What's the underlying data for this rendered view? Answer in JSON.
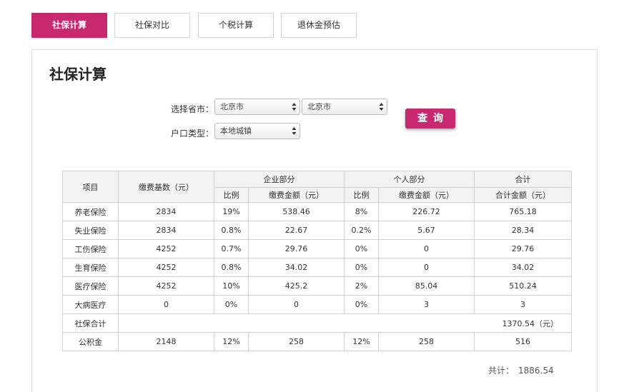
{
  "tabs": [
    {
      "label": "社保计算",
      "active": true
    },
    {
      "label": "社保对比",
      "active": false
    },
    {
      "label": "个税计算",
      "active": false
    },
    {
      "label": "退休金预估",
      "active": false
    }
  ],
  "panel": {
    "title": "社保计算",
    "form": {
      "region_label": "选择省市：",
      "province": "北京市",
      "city": "北京市",
      "hukou_label": "户口类型：",
      "hukou": "本地城镇",
      "query_label": "查询"
    },
    "table": {
      "headers": {
        "item": "项目",
        "base": "缴费基数（元）",
        "enterprise": "企业部分",
        "personal": "个人部分",
        "total": "合计",
        "ratio": "比例",
        "amount": "缴费金额（元）",
        "total_amount": "合计金额（元）"
      },
      "rows": [
        {
          "item": "养老保险",
          "base": "2834",
          "e_ratio": "19%",
          "e_amount": "538.46",
          "p_ratio": "8%",
          "p_amount": "226.72",
          "total": "765.18"
        },
        {
          "item": "失业保险",
          "base": "2834",
          "e_ratio": "0.8%",
          "e_amount": "22.67",
          "p_ratio": "0.2%",
          "p_amount": "5.67",
          "total": "28.34"
        },
        {
          "item": "工伤保险",
          "base": "4252",
          "e_ratio": "0.7%",
          "e_amount": "29.76",
          "p_ratio": "0%",
          "p_amount": "0",
          "total": "29.76"
        },
        {
          "item": "生育保险",
          "base": "4252",
          "e_ratio": "0.8%",
          "e_amount": "34.02",
          "p_ratio": "0%",
          "p_amount": "0",
          "total": "34.02"
        },
        {
          "item": "医疗保险",
          "base": "4252",
          "e_ratio": "10%",
          "e_amount": "425.2",
          "p_ratio": "2%",
          "p_amount": "85.04",
          "total": "510.24"
        },
        {
          "item": "大病医疗",
          "base": "0",
          "e_ratio": "0%",
          "e_amount": "0",
          "p_ratio": "0%",
          "p_amount": "3",
          "total": "3"
        }
      ],
      "social_total": {
        "label": "社保合计",
        "value": "1370.54（元）"
      },
      "fund": {
        "item": "公积金",
        "base": "2148",
        "e_ratio": "12%",
        "e_amount": "258",
        "p_ratio": "12%",
        "p_amount": "258",
        "total": "516"
      }
    },
    "grand_total": {
      "label": "共计：",
      "value": "1886.54"
    }
  }
}
